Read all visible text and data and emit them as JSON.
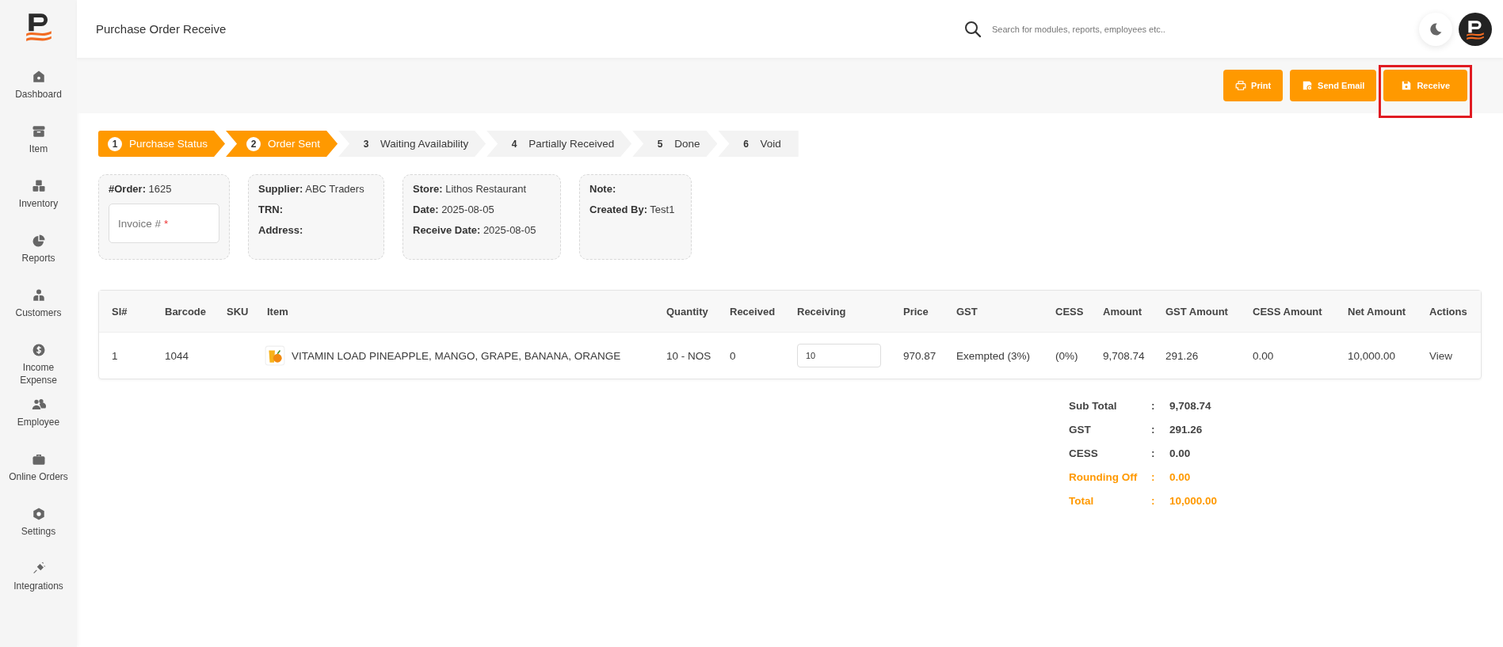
{
  "page_title": "Purchase Order Receive",
  "search": {
    "placeholder": "Search for modules, reports, employees etc.."
  },
  "sidebar": {
    "items": [
      {
        "label": "Dashboard",
        "selected": false
      },
      {
        "label": "Item",
        "selected": false
      },
      {
        "label": "Inventory",
        "selected": false
      },
      {
        "label": "Reports",
        "selected": false
      },
      {
        "label": "Customers",
        "selected": false
      },
      {
        "label": "Income Expense",
        "selected": false
      },
      {
        "label": "Employee",
        "selected": false
      },
      {
        "label": "Online Orders",
        "selected": false
      },
      {
        "label": "Settings",
        "selected": false
      },
      {
        "label": "Integrations",
        "selected": false
      }
    ]
  },
  "actions": [
    {
      "label": "Print",
      "highlighted": false
    },
    {
      "label": "Send Email",
      "highlighted": false
    },
    {
      "label": "Receive",
      "highlighted": true
    }
  ],
  "steps": [
    {
      "number": "1",
      "label": "Purchase Status",
      "completed": true
    },
    {
      "number": "2",
      "label": "Order Sent",
      "completed": true
    },
    {
      "number": "3",
      "label": "Waiting Availability",
      "completed": false
    },
    {
      "number": "4",
      "label": "Partially Received",
      "completed": false
    },
    {
      "number": "5",
      "label": "Done",
      "completed": false
    },
    {
      "number": "6",
      "label": "Void",
      "completed": false
    }
  ],
  "info_cards": [
    {
      "fields": [
        {
          "label": "#Order:",
          "value": "1625"
        }
      ],
      "invoice_field": {
        "placeholder": "Invoice #",
        "required_mark": "*"
      }
    },
    {
      "fields": [
        {
          "label": "Supplier:",
          "value": "ABC Traders"
        },
        {
          "label": "TRN:"
        },
        {
          "label": "Address:"
        }
      ]
    },
    {
      "fields": [
        {
          "label": "Store:",
          "value": "Lithos Restaurant"
        },
        {
          "label": "Date:",
          "value": "2025-08-05"
        },
        {
          "label": "Receive Date:",
          "value": "2025-08-05"
        }
      ]
    },
    {
      "fields": [
        {
          "label": "Note:"
        },
        {
          "label": "Created By:",
          "value": "Test1"
        }
      ]
    }
  ],
  "table": {
    "columns": [
      "Sl#",
      "Barcode",
      "SKU",
      "Item",
      "Quantity",
      "Received",
      "Receiving",
      "Price",
      "GST",
      "CESS",
      "Amount",
      "GST Amount",
      "CESS Amount",
      "Net Amount",
      "Actions"
    ],
    "rows": [
      {
        "sl": "1",
        "barcode": "1044",
        "sku": "",
        "item": "VITAMIN LOAD PINEAPPLE, MANGO, GRAPE, BANANA, ORANGE",
        "quantity": "10 - NOS",
        "received": "0",
        "receiving": "10",
        "price": "970.87",
        "gst": "Exempted (3%)",
        "cess": "(0%)",
        "amount": "9,708.74",
        "gst_amount": "291.26",
        "cess_amount": "0.00",
        "net_amount": "10,000.00",
        "action": "View"
      }
    ]
  },
  "totals": [
    {
      "label": "Sub Total",
      "separator": ":",
      "value": "9,708.74",
      "highlighted": false
    },
    {
      "label": "GST",
      "separator": ":",
      "value": "291.26",
      "highlighted": false
    },
    {
      "label": "CESS",
      "separator": ":",
      "value": "0.00",
      "highlighted": false
    },
    {
      "label": "Rounding Off",
      "separator": ":",
      "value": "0.00",
      "highlighted": true
    },
    {
      "label": "Total",
      "separator": ":",
      "value": "10,000.00",
      "highlighted": true
    }
  ]
}
